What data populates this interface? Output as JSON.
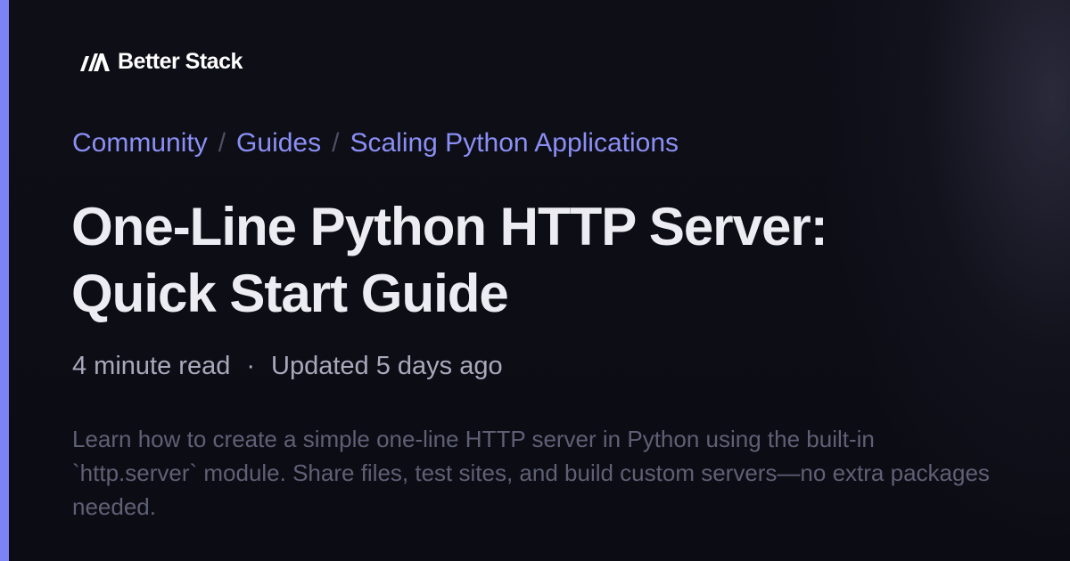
{
  "brand": {
    "logo_icon": "better-stack-logo-icon",
    "name": "Better Stack",
    "accent_color": "#7c83f5"
  },
  "breadcrumb": {
    "items": [
      {
        "label": "Community"
      },
      {
        "label": "Guides"
      },
      {
        "label": "Scaling Python Applications"
      }
    ],
    "separator": "/"
  },
  "article": {
    "title_line_1": "One-Line Python HTTP Server:",
    "title_line_2": "Quick Start Guide",
    "read_time": "4 minute read",
    "meta_separator": "·",
    "updated": "Updated 5 days ago",
    "description": "Learn how to create a simple one-line HTTP server in Python using the built-in `http.server` module. Share files, test sites, and build custom servers—no extra packages needed."
  },
  "colors": {
    "background": "#0d0d15",
    "title": "#ececf2",
    "link": "#8b8ff5",
    "meta": "#a8aabc",
    "description": "#5e6075"
  }
}
